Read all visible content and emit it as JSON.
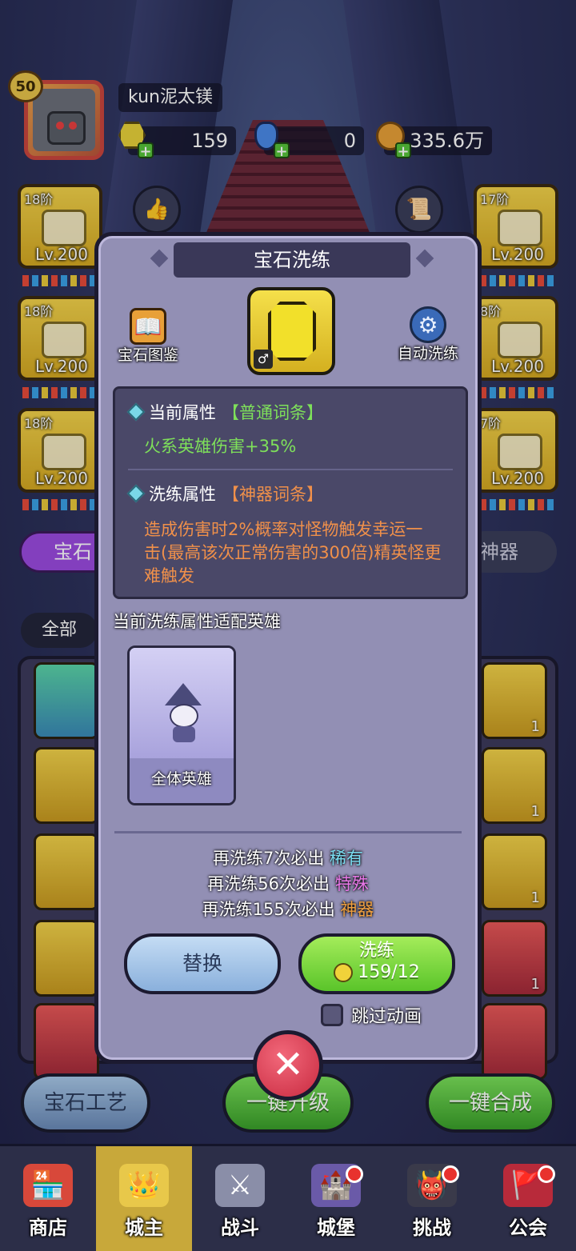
{
  "player": {
    "level": "50",
    "name": "kun泥太镁"
  },
  "currencies": {
    "gems": "159",
    "potions": "0",
    "gold": "335.6万"
  },
  "equipment_slots": [
    {
      "stage": "18阶",
      "level": "Lv.200"
    },
    {
      "stage": "18阶",
      "level": "Lv.200"
    },
    {
      "stage": "18阶",
      "level": "Lv.200"
    },
    {
      "stage": "17阶",
      "level": "Lv.200"
    },
    {
      "stage": "8阶",
      "level": "Lv.200"
    },
    {
      "stage": "7阶",
      "level": "Lv.200"
    }
  ],
  "background_tabs": {
    "gem_tab": "宝石",
    "artifact_tab": "神器",
    "filter_all": "全部"
  },
  "background_gem_counts": [
    "1",
    "1",
    "1",
    "1"
  ],
  "background_buttons": {
    "craft": "宝石工艺",
    "upgrade": "一键升级",
    "merge": "一键合成"
  },
  "modal": {
    "title": "宝石洗练",
    "codex_label": "宝石图鉴",
    "auto_label": "自动洗练",
    "current_attr_label": "当前属性",
    "current_attr_tier": "【普通词条】",
    "current_attr_value": "火系英雄伤害+35%",
    "refine_attr_label": "洗练属性",
    "refine_attr_tier": "【神器词条】",
    "refine_attr_line1": "造成伤害时2%概率对怪物触发幸运一",
    "refine_attr_line2": "击(最高该次正常伤害的300倍)精英怪更",
    "refine_attr_line3": "难触发",
    "fit_heroes_label": "当前洗练属性适配英雄",
    "hero_card_name": "全体英雄",
    "pity": [
      {
        "prefix": "再洗练7次必出",
        "tier": "稀有"
      },
      {
        "prefix": "再洗练56次必出",
        "tier": "特殊"
      },
      {
        "prefix": "再洗练155次必出",
        "tier": "神器"
      }
    ],
    "replace_button": "替换",
    "refine_button": "洗练",
    "refine_cost": "159/12",
    "skip_animation": "跳过动画"
  },
  "bottom_nav": [
    {
      "label": "商店",
      "icon": "shop-icon"
    },
    {
      "label": "城主",
      "icon": "crown-icon"
    },
    {
      "label": "战斗",
      "icon": "swords-icon"
    },
    {
      "label": "城堡",
      "icon": "castle-icon"
    },
    {
      "label": "挑战",
      "icon": "demon-icon"
    },
    {
      "label": "公会",
      "icon": "guild-banner-icon"
    }
  ]
}
